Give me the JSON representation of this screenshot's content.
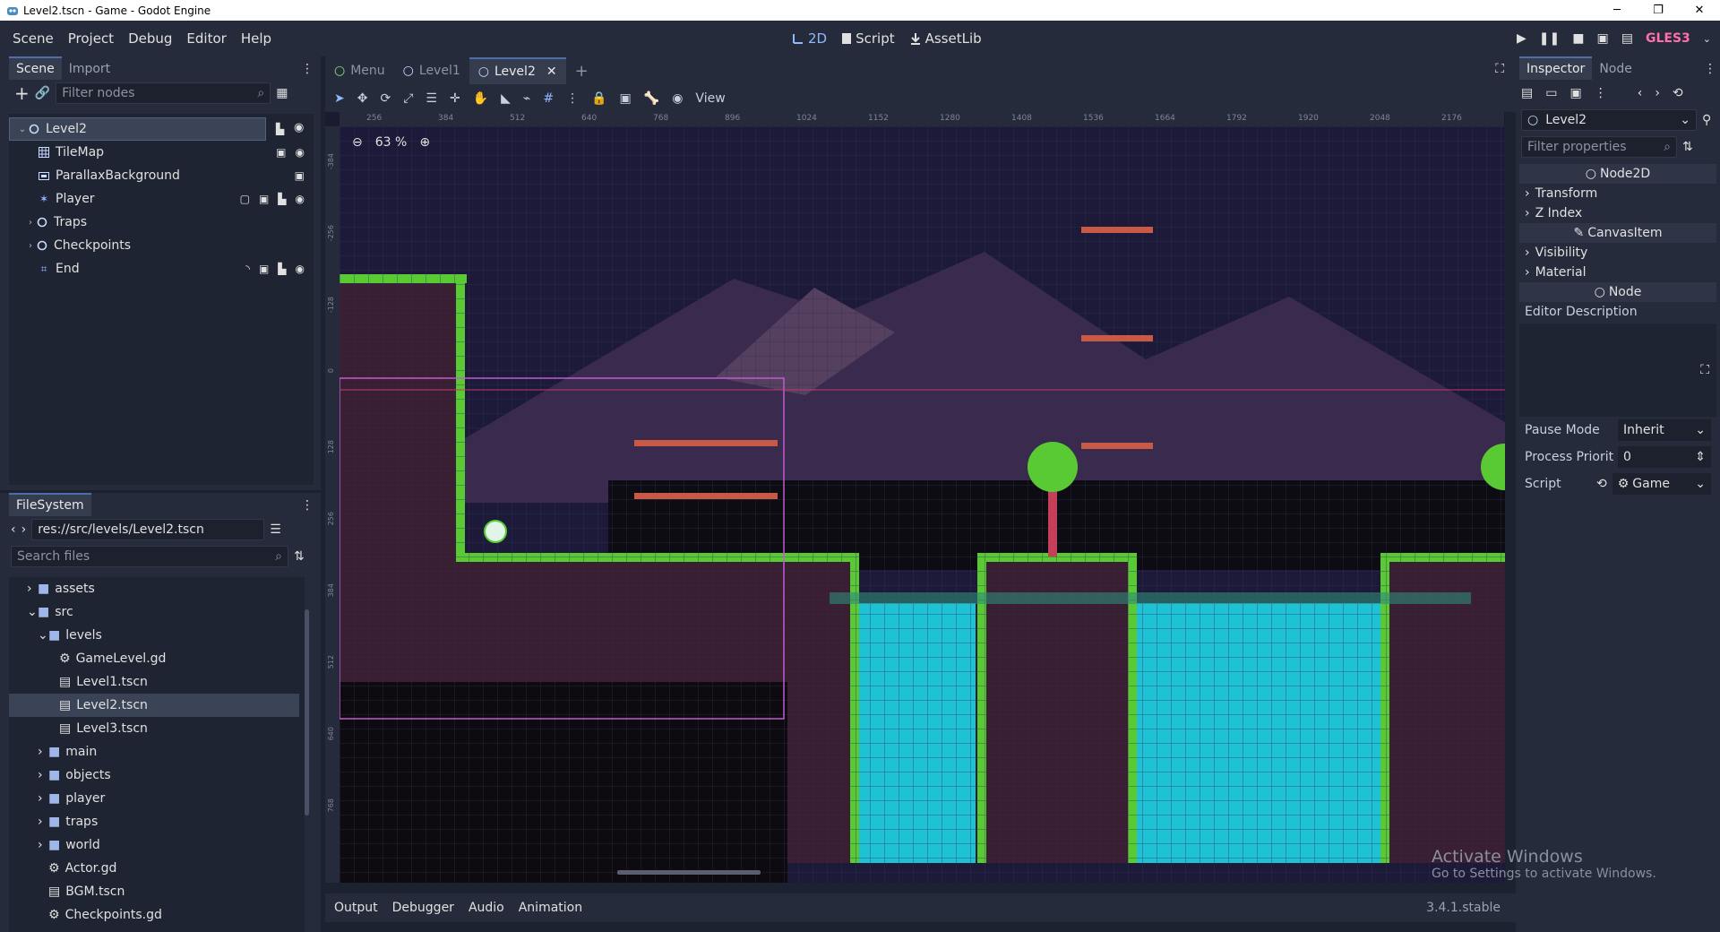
{
  "window": {
    "title": "Level2.tscn - Game - Godot Engine",
    "minimize": "─",
    "maximize": "❐",
    "close": "✕"
  },
  "menu": {
    "items": [
      "Scene",
      "Project",
      "Debug",
      "Editor",
      "Help"
    ]
  },
  "workspaces": {
    "two_d": "2D",
    "script": "Script",
    "assetlib": "AssetLib"
  },
  "renderer": "GLES3",
  "scene_panel": {
    "tabs": [
      "Scene",
      "Import"
    ],
    "filter_placeholder": "Filter nodes",
    "nodes": [
      {
        "label": "Level2",
        "icon": "node2d-circle-icon"
      },
      {
        "label": "TileMap",
        "icon": "tilemap-grid-icon"
      },
      {
        "label": "ParallaxBackground",
        "icon": "parallax-icon"
      },
      {
        "label": "Player",
        "icon": "player-icon"
      },
      {
        "label": "Traps",
        "icon": "node2d-circle-icon"
      },
      {
        "label": "Checkpoints",
        "icon": "node2d-circle-icon"
      },
      {
        "label": "End",
        "icon": "area-icon"
      }
    ]
  },
  "filesystem": {
    "tab": "FileSystem",
    "path": "res://src/levels/Level2.tscn",
    "search_placeholder": "Search files",
    "items": [
      {
        "label": "assets",
        "type": "folder"
      },
      {
        "label": "src",
        "type": "folder"
      },
      {
        "label": "levels",
        "type": "folder"
      },
      {
        "label": "GameLevel.gd",
        "type": "script"
      },
      {
        "label": "Level1.tscn",
        "type": "scene"
      },
      {
        "label": "Level2.tscn",
        "type": "scene"
      },
      {
        "label": "Level3.tscn",
        "type": "scene"
      },
      {
        "label": "main",
        "type": "folder"
      },
      {
        "label": "objects",
        "type": "folder"
      },
      {
        "label": "player",
        "type": "folder"
      },
      {
        "label": "traps",
        "type": "folder"
      },
      {
        "label": "world",
        "type": "folder"
      },
      {
        "label": "Actor.gd",
        "type": "script"
      },
      {
        "label": "BGM.tscn",
        "type": "scene"
      },
      {
        "label": "Checkpoints.gd",
        "type": "script"
      }
    ]
  },
  "editor_tabs": [
    "Menu",
    "Level1",
    "Level2"
  ],
  "toolbar": {
    "view": "View"
  },
  "viewport": {
    "zoom": "63 %",
    "ruler_h": [
      "256",
      "384",
      "512",
      "640",
      "768",
      "896",
      "1024",
      "1152",
      "1280",
      "1408",
      "1536",
      "1664",
      "1792",
      "1920",
      "2048",
      "2176"
    ],
    "ruler_v": [
      "-384",
      "-256",
      "-128",
      "0",
      "128",
      "256",
      "384",
      "512",
      "640",
      "768"
    ]
  },
  "bottom_tabs": [
    "Output",
    "Debugger",
    "Audio",
    "Animation"
  ],
  "version": "3.4.1.stable",
  "inspector": {
    "tabs": [
      "Inspector",
      "Node"
    ],
    "object": "Level2",
    "filter_placeholder": "Filter properties",
    "section_node2d": "Node2D",
    "rows_node2d": [
      "Transform",
      "Z Index"
    ],
    "section_canvasitem": "CanvasItem",
    "rows_canvasitem": [
      "Visibility",
      "Material"
    ],
    "section_node": "Node",
    "editor_description": "Editor Description",
    "pause_mode_label": "Pause Mode",
    "pause_mode_value": "Inherit",
    "process_priority_label": "Process Priorit",
    "process_priority_value": "0",
    "script_label": "Script",
    "script_value": "Game"
  },
  "watermark": {
    "title": "Activate Windows",
    "subtitle": "Go to Settings to activate Windows."
  },
  "colors": {
    "accent": "#8eb8ff",
    "gles": "#ff6fae",
    "water": "#1fc1d4",
    "grass": "#59c934"
  }
}
